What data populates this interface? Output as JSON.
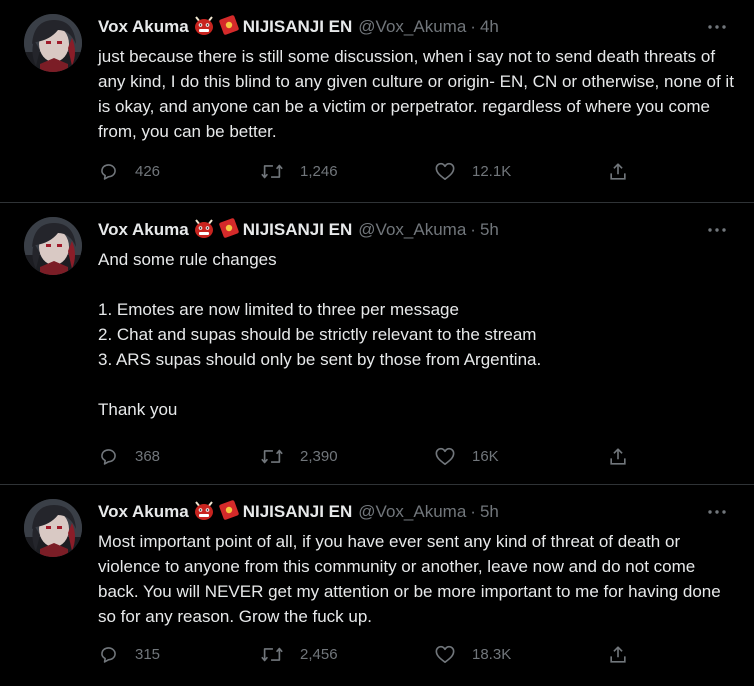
{
  "colors": {
    "background": "#000000",
    "text": "#e7e9ea",
    "muted": "#71767b",
    "divider": "#2f3336"
  },
  "icons": {
    "badge": [
      "ogre-face-emoji",
      "red-envelope-emoji"
    ],
    "actions": [
      "reply-icon",
      "retweet-icon",
      "like-icon",
      "share-icon"
    ],
    "menu": "more-icon"
  },
  "tweets": [
    {
      "name": "Vox Akuma",
      "affiliation": "NIJISANJI EN",
      "handle": "@Vox_Akuma",
      "separator": "·",
      "time": "4h",
      "text": "just because there is still some discussion, when i say not to send death threats of any kind, I do this blind to any given culture or origin- EN, CN or otherwise, none of it is okay, and anyone can be a victim or perpetrator. regardless of where you come from, you can be better.",
      "replies": "426",
      "retweets": "1,246",
      "likes": "12.1K"
    },
    {
      "name": "Vox Akuma",
      "affiliation": "NIJISANJI EN",
      "handle": "@Vox_Akuma",
      "separator": "·",
      "time": "5h",
      "text": "And some rule changes\n\n1. Emotes are now limited to three per message\n2. Chat and supas should be strictly relevant to the stream\n3. ARS supas should only be sent by those from Argentina.\n\nThank you",
      "replies": "368",
      "retweets": "2,390",
      "likes": "16K"
    },
    {
      "name": "Vox Akuma",
      "affiliation": "NIJISANJI EN",
      "handle": "@Vox_Akuma",
      "separator": "·",
      "time": "5h",
      "text": "Most important point of all, if you have ever sent any kind of threat of death or violence to anyone from this community or another, leave now and do not come back. You will NEVER get my attention or be more important to me for having done so for any reason. Grow the fuck up.",
      "replies": "315",
      "retweets": "2,456",
      "likes": "18.3K"
    }
  ]
}
